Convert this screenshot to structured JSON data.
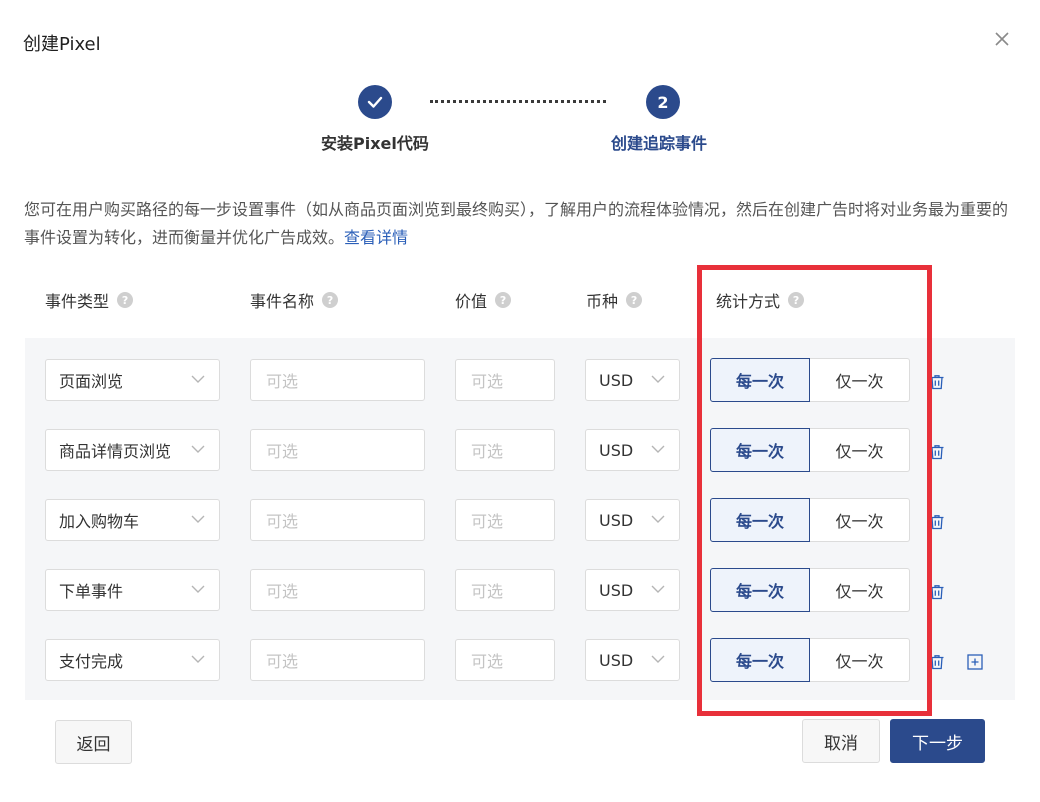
{
  "dialog": {
    "title": "创建Pixel"
  },
  "stepper": {
    "steps": [
      {
        "label": "安装Pixel代码",
        "status": "done"
      },
      {
        "label": "创建追踪事件",
        "number": "2",
        "status": "active"
      }
    ],
    "active_color": "#2b4a8c"
  },
  "description": {
    "text": "您可在用户购买路径的每一步设置事件（如从商品页面浏览到最终购买），了解用户的流程体验情况，然后在创建广告时将对业务最为重要的事件设置为转化，进而衡量并优化广告成效。",
    "link": "查看详情"
  },
  "columns": {
    "event_type": "事件类型",
    "event_name": "事件名称",
    "value": "价值",
    "currency": "币种",
    "count_method": "统计方式",
    "help_glyph": "?"
  },
  "placeholders": {
    "event_name": "可选",
    "value": "可选"
  },
  "count_options": {
    "every": "每一次",
    "once": "仅一次"
  },
  "rows": [
    {
      "event_type": "页面浏览",
      "currency": "USD",
      "count": "每一次"
    },
    {
      "event_type": "商品详情页浏览",
      "currency": "USD",
      "count": "每一次"
    },
    {
      "event_type": "加入购物车",
      "currency": "USD",
      "count": "每一次"
    },
    {
      "event_type": "下单事件",
      "currency": "USD",
      "count": "每一次"
    },
    {
      "event_type": "支付完成",
      "currency": "USD",
      "count": "每一次"
    }
  ],
  "footer": {
    "back": "返回",
    "cancel": "取消",
    "next": "下一步"
  },
  "colors": {
    "primary": "#2b4a8c",
    "highlight": "#e8303a",
    "link": "#2b5fb8"
  }
}
